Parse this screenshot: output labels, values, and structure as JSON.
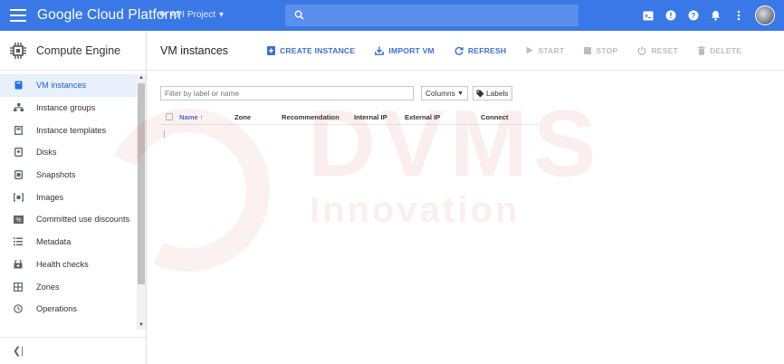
{
  "topbar": {
    "brand": "Google Cloud Platform",
    "project": "API Project",
    "accent": "#3b78e7"
  },
  "sidebar": {
    "title": "Compute Engine",
    "items": [
      {
        "label": "VM instances",
        "icon": "vm-instance-icon"
      },
      {
        "label": "Instance groups",
        "icon": "instance-groups-icon"
      },
      {
        "label": "Instance templates",
        "icon": "instance-templates-icon"
      },
      {
        "label": "Disks",
        "icon": "disk-icon"
      },
      {
        "label": "Snapshots",
        "icon": "snapshot-icon"
      },
      {
        "label": "Images",
        "icon": "image-icon"
      },
      {
        "label": "Committed use discounts",
        "icon": "discount-icon"
      },
      {
        "label": "Metadata",
        "icon": "metadata-icon"
      },
      {
        "label": "Health checks",
        "icon": "health-check-icon"
      },
      {
        "label": "Zones",
        "icon": "zones-icon"
      },
      {
        "label": "Operations",
        "icon": "operations-icon"
      }
    ]
  },
  "main": {
    "title": "VM instances",
    "actions": {
      "create": "CREATE INSTANCE",
      "import": "IMPORT VM",
      "refresh": "REFRESH",
      "start": "START",
      "stop": "STOP",
      "reset": "RESET",
      "delete": "DELETE"
    },
    "filter_placeholder": "Filter by label or name",
    "columns_label": "Columns",
    "labels_label": "Labels",
    "table_headers": {
      "name": "Name",
      "zone": "Zone",
      "recommendation": "Recommendation",
      "internal_ip": "Internal IP",
      "external_ip": "External IP",
      "connect": "Connect"
    }
  },
  "watermark": {
    "line1": "DVMS",
    "line2": "Innovation"
  }
}
